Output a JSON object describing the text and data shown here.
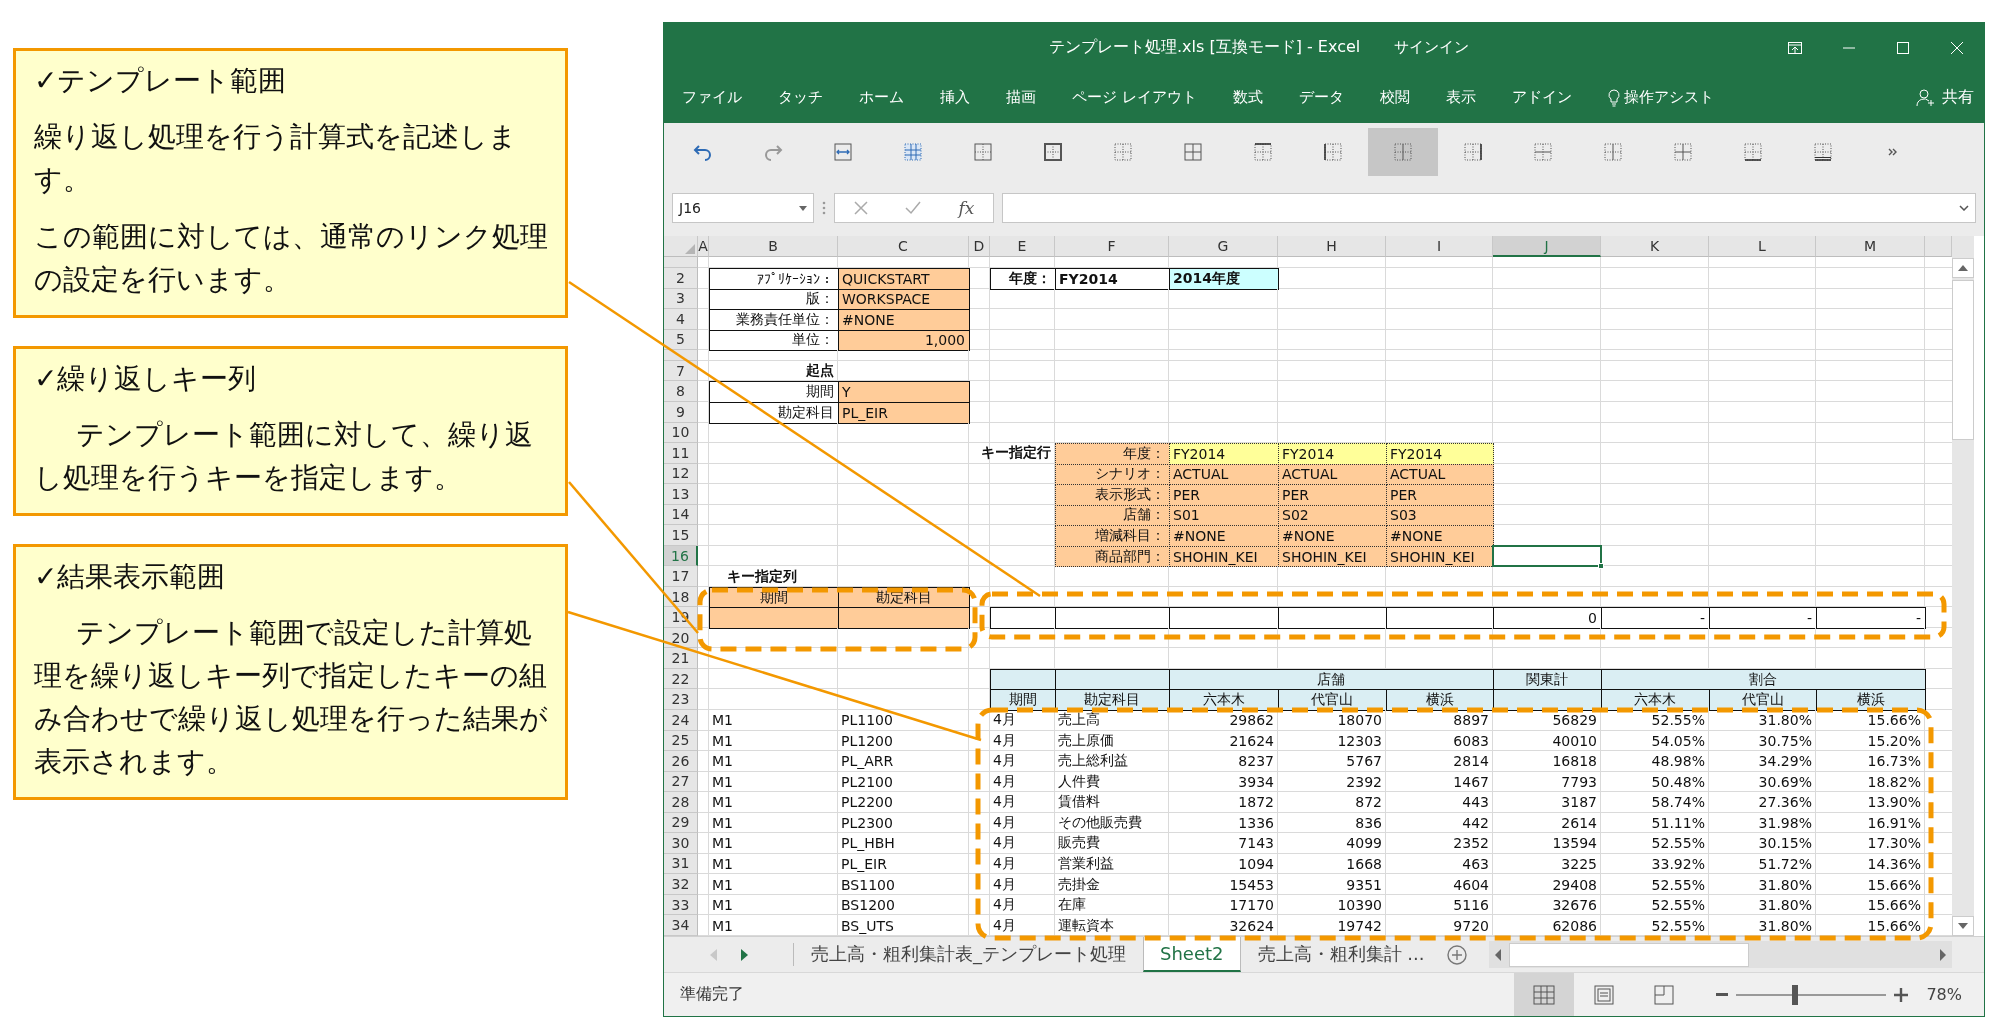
{
  "callouts": [
    {
      "title": "✓テンプレート範囲",
      "paragraphs": [
        {
          "text": "繰り返し処理を行う計算式を記述します。",
          "indent": false
        },
        {
          "text": "この範囲に対しては、通常のリンク処理の設定を行います。",
          "indent": false
        }
      ]
    },
    {
      "title": "✓繰り返しキー列",
      "paragraphs": [
        {
          "text": "テンプレート範囲に対して、繰り返し処理を行うキーを指定します。",
          "indent": true
        }
      ]
    },
    {
      "title": "✓結果表示範囲",
      "paragraphs": [
        {
          "text": "テンプレート範囲で設定した計算処理を繰り返しキー列で指定したキーの組み合わせで繰り返し処理を行った結果が表示されます。",
          "indent": true
        }
      ]
    }
  ],
  "window": {
    "title": "テンプレート処理.xls [互換モード] - Excel",
    "sign_in": "サインイン"
  },
  "menu": [
    "ファイル",
    "タッチ",
    "ホーム",
    "挿入",
    "描画",
    "ページ レイアウト",
    "数式",
    "データ",
    "校閲",
    "表示",
    "アドイン"
  ],
  "tell_me": "操作アシスト",
  "share": "共有",
  "toolbar": [
    {
      "kind": "undo",
      "selected": false
    },
    {
      "kind": "redo",
      "selected": false
    },
    {
      "kind": "merge",
      "selected": false
    },
    {
      "kind": "table",
      "selected": false
    },
    {
      "kind": "inner",
      "selected": false
    },
    {
      "kind": "thick",
      "selected": false
    },
    {
      "kind": "dotted",
      "selected": false
    },
    {
      "kind": "all",
      "selected": false
    },
    {
      "kind": "top",
      "selected": false
    },
    {
      "kind": "left",
      "selected": false
    },
    {
      "kind": "center",
      "selected": true
    },
    {
      "kind": "right",
      "selected": false
    },
    {
      "kind": "horizontal",
      "selected": false
    },
    {
      "kind": "vertical",
      "selected": false
    },
    {
      "kind": "cross",
      "selected": false
    },
    {
      "kind": "bottom",
      "selected": false
    },
    {
      "kind": "double",
      "selected": false
    },
    {
      "kind": "more",
      "selected": false
    }
  ],
  "formula_bar": {
    "name_box": "J16",
    "function_label": "fx"
  },
  "sheet": {
    "columns": [
      {
        "label": "A",
        "selected": false
      },
      {
        "label": "B",
        "selected": false
      },
      {
        "label": "C",
        "selected": false
      },
      {
        "label": "D",
        "selected": false
      },
      {
        "label": "E",
        "selected": false
      },
      {
        "label": "F",
        "selected": false
      },
      {
        "label": "G",
        "selected": false
      },
      {
        "label": "H",
        "selected": false
      },
      {
        "label": "I",
        "selected": false
      },
      {
        "label": "J",
        "selected": true
      },
      {
        "label": "K",
        "selected": false
      },
      {
        "label": "L",
        "selected": false
      },
      {
        "label": "M",
        "selected": false
      }
    ],
    "row_numbers": [
      {
        "label": "2",
        "selected": false
      },
      {
        "label": "3",
        "selected": false
      },
      {
        "label": "4",
        "selected": false
      },
      {
        "label": "5",
        "selected": false
      },
      {
        "label": "7",
        "selected": false
      },
      {
        "label": "8",
        "selected": false
      },
      {
        "label": "9",
        "selected": false
      },
      {
        "label": "10",
        "selected": false
      },
      {
        "label": "11",
        "selected": false
      },
      {
        "label": "12",
        "selected": false
      },
      {
        "label": "13",
        "selected": false
      },
      {
        "label": "14",
        "selected": false
      },
      {
        "label": "15",
        "selected": false
      },
      {
        "label": "16",
        "selected": true
      },
      {
        "label": "17",
        "selected": false
      },
      {
        "label": "18",
        "selected": false
      },
      {
        "label": "19",
        "selected": false
      },
      {
        "label": "20",
        "selected": false
      },
      {
        "label": "21",
        "selected": false
      },
      {
        "label": "22",
        "selected": false
      },
      {
        "label": "23",
        "selected": false
      },
      {
        "label": "24",
        "selected": false
      },
      {
        "label": "25",
        "selected": false
      },
      {
        "label": "26",
        "selected": false
      },
      {
        "label": "27",
        "selected": false
      },
      {
        "label": "28",
        "selected": false
      },
      {
        "label": "29",
        "selected": false
      },
      {
        "label": "30",
        "selected": false
      },
      {
        "label": "31",
        "selected": false
      },
      {
        "label": "32",
        "selected": false
      },
      {
        "label": "33",
        "selected": false
      },
      {
        "label": "34",
        "selected": false
      }
    ],
    "settings": [
      {
        "label": "ｱﾌﾟﾘｹｰｼｮﾝ：",
        "value": "QUICKSTART",
        "kind": "text"
      },
      {
        "label": "版：",
        "value": "WORKSPACE",
        "kind": "text"
      },
      {
        "label": "業務責任単位：",
        "value": "#NONE",
        "kind": "text"
      },
      {
        "label": "単位：",
        "value": "1,000",
        "kind": "number"
      }
    ],
    "fiscal_year": {
      "label": "年度：",
      "value": "FY2014",
      "display": "2014年度"
    },
    "origin": {
      "title": "起点",
      "rows": [
        {
          "label": "期間",
          "value": "Y"
        },
        {
          "label": "勘定科目",
          "value": "PL_EIR"
        }
      ]
    },
    "key_rows": {
      "title": "キー指定行",
      "rows": [
        {
          "label": "年度：",
          "kind": "year",
          "values": [
            "FY2014",
            "FY2014",
            "FY2014"
          ]
        },
        {
          "label": "シナリオ：",
          "kind": "key",
          "values": [
            "ACTUAL",
            "ACTUAL",
            "ACTUAL"
          ]
        },
        {
          "label": "表示形式：",
          "kind": "key",
          "values": [
            "PER",
            "PER",
            "PER"
          ]
        },
        {
          "label": "店舗：",
          "kind": "key",
          "values": [
            "S01",
            "S02",
            "S03"
          ]
        },
        {
          "label": "増減科目：",
          "kind": "key",
          "values": [
            "#NONE",
            "#NONE",
            "#NONE"
          ]
        },
        {
          "label": "商品部門：",
          "kind": "key",
          "values": [
            "SHOHIN_KEI",
            "SHOHIN_KEI",
            "SHOHIN_KEI"
          ]
        }
      ]
    },
    "key_columns": {
      "title": "キー指定列",
      "headers": [
        "期間",
        "勘定科目"
      ]
    },
    "template_row": {
      "values": [
        "0",
        "-",
        "-",
        "-"
      ]
    },
    "results": {
      "groups": [
        "店舗",
        "関東計",
        "割合"
      ],
      "headers": [
        "期間",
        "勘定科目",
        "六本木",
        "代官山",
        "横浜",
        "六本木",
        "代官山",
        "横浜"
      ],
      "rows": [
        {
          "segment": "M1",
          "code": "PL1100",
          "period": "4月",
          "account": "売上高",
          "values": [
            "29862",
            "18070",
            "8897",
            "56829",
            "52.55%",
            "31.80%",
            "15.66%"
          ]
        },
        {
          "segment": "M1",
          "code": "PL1200",
          "period": "4月",
          "account": "売上原価",
          "values": [
            "21624",
            "12303",
            "6083",
            "40010",
            "54.05%",
            "30.75%",
            "15.20%"
          ]
        },
        {
          "segment": "M1",
          "code": "PL_ARR",
          "period": "4月",
          "account": "売上総利益",
          "values": [
            "8237",
            "5767",
            "2814",
            "16818",
            "48.98%",
            "34.29%",
            "16.73%"
          ]
        },
        {
          "segment": "M1",
          "code": "PL2100",
          "period": "4月",
          "account": "人件費",
          "values": [
            "3934",
            "2392",
            "1467",
            "7793",
            "50.48%",
            "30.69%",
            "18.82%"
          ]
        },
        {
          "segment": "M1",
          "code": "PL2200",
          "period": "4月",
          "account": "賃借料",
          "values": [
            "1872",
            "872",
            "443",
            "3187",
            "58.74%",
            "27.36%",
            "13.90%"
          ]
        },
        {
          "segment": "M1",
          "code": "PL2300",
          "period": "4月",
          "account": "その他販売費",
          "values": [
            "1336",
            "836",
            "442",
            "2614",
            "51.11%",
            "31.98%",
            "16.91%"
          ]
        },
        {
          "segment": "M1",
          "code": "PL_HBH",
          "period": "4月",
          "account": "販売費",
          "values": [
            "7143",
            "4099",
            "2352",
            "13594",
            "52.55%",
            "30.15%",
            "17.30%"
          ]
        },
        {
          "segment": "M1",
          "code": "PL_EIR",
          "period": "4月",
          "account": "営業利益",
          "values": [
            "1094",
            "1668",
            "463",
            "3225",
            "33.92%",
            "51.72%",
            "14.36%"
          ]
        },
        {
          "segment": "M1",
          "code": "BS1100",
          "period": "4月",
          "account": "売掛金",
          "values": [
            "15453",
            "9351",
            "4604",
            "29408",
            "52.55%",
            "31.80%",
            "15.66%"
          ]
        },
        {
          "segment": "M1",
          "code": "BS1200",
          "period": "4月",
          "account": "在庫",
          "values": [
            "17170",
            "10390",
            "5116",
            "32676",
            "52.55%",
            "31.80%",
            "15.66%"
          ]
        },
        {
          "segment": "M1",
          "code": "BS_UTS",
          "period": "4月",
          "account": "運転資本",
          "values": [
            "32624",
            "19742",
            "9720",
            "62086",
            "52.55%",
            "31.80%",
            "15.66%"
          ]
        }
      ]
    }
  },
  "sheet_tabs": [
    {
      "label": "売上高・粗利集計表_テンプレート処理",
      "selected": false
    },
    {
      "label": "Sheet2",
      "selected": true
    },
    {
      "label": "売上高・粗利集計 ...",
      "selected": false
    }
  ],
  "status_bar": {
    "text": "準備完了",
    "views": [
      {
        "kind": "normal",
        "selected": true
      },
      {
        "kind": "page_layout",
        "selected": false
      },
      {
        "kind": "page_break",
        "selected": false
      }
    ],
    "zoom": {
      "level": 0.39,
      "reading": "78%"
    }
  }
}
